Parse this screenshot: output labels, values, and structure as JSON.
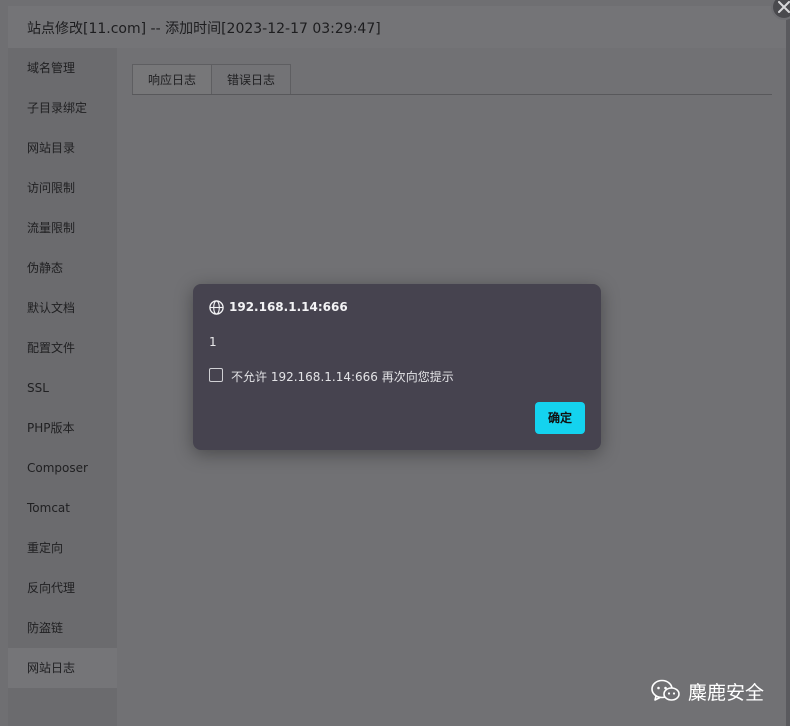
{
  "window": {
    "title": "站点修改[11.com] -- 添加时间[2023-12-17 03:29:47]"
  },
  "sidebar": {
    "items": [
      {
        "label": "域名管理"
      },
      {
        "label": "子目录绑定"
      },
      {
        "label": "网站目录"
      },
      {
        "label": "访问限制"
      },
      {
        "label": "流量限制"
      },
      {
        "label": "伪静态"
      },
      {
        "label": "默认文档"
      },
      {
        "label": "配置文件"
      },
      {
        "label": "SSL"
      },
      {
        "label": "PHP版本"
      },
      {
        "label": "Composer"
      },
      {
        "label": "Tomcat"
      },
      {
        "label": "重定向"
      },
      {
        "label": "反向代理"
      },
      {
        "label": "防盗链"
      },
      {
        "label": "网站日志",
        "active": true
      }
    ]
  },
  "main": {
    "tabs": [
      {
        "label": "响应日志",
        "active": true
      },
      {
        "label": "错误日志"
      }
    ]
  },
  "dialog": {
    "origin": "192.168.1.14:666",
    "message": "1",
    "checkbox_label": "不允许 192.168.1.14:666 再次向您提示",
    "ok_label": "确定",
    "accent_color": "#14d3ef"
  },
  "watermark": {
    "text": "麋鹿安全",
    "icon": "wechat-icon"
  }
}
